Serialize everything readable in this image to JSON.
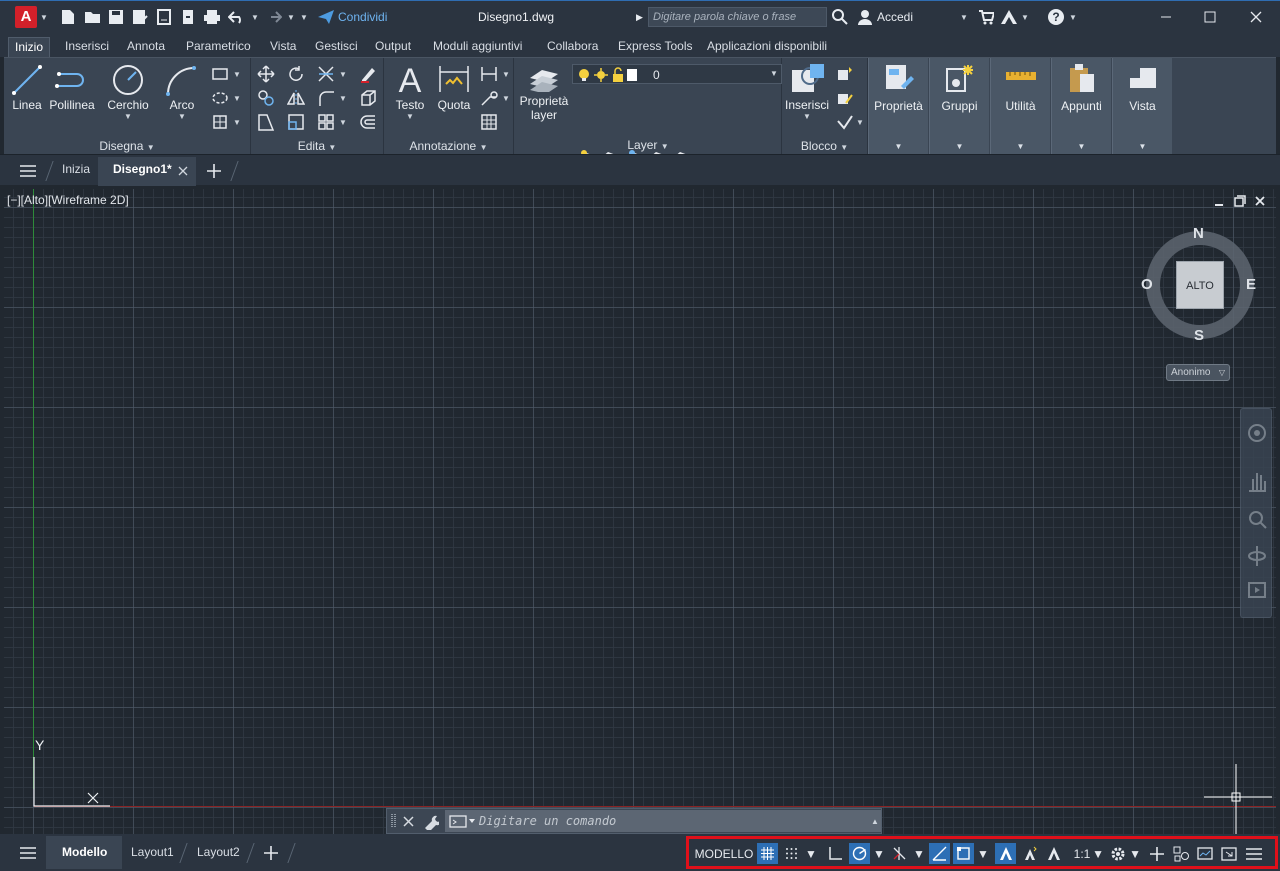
{
  "app": {
    "logo_letter": "A",
    "document_title": "Disegno1.dwg",
    "share_label": "Condividi",
    "search_placeholder": "Digitare parola chiave o frase",
    "signin_label": "Accedi"
  },
  "ribbon_tabs": [
    "Inizio",
    "Inserisci",
    "Annota",
    "Parametrico",
    "Vista",
    "Gestisci",
    "Output",
    "Moduli aggiuntivi",
    "Collabora",
    "Express Tools",
    "Applicazioni disponibili"
  ],
  "ribbon": {
    "draw": {
      "title": "Disegna",
      "line": "Linea",
      "polyline": "Polilinea",
      "circle": "Cerchio",
      "arc": "Arco"
    },
    "modify": {
      "title": "Edita"
    },
    "annotation": {
      "title": "Annotazione",
      "text": "Testo",
      "dimension": "Quota"
    },
    "layers": {
      "title": "Layer",
      "properties_l1": "Proprietà",
      "properties_l2": "layer",
      "current_layer": "0"
    },
    "block": {
      "title": "Blocco",
      "insert": "Inserisci"
    },
    "properties": "Proprietà",
    "groups": "Gruppi",
    "utilities": "Utilità",
    "clipboard": "Appunti",
    "view": "Vista"
  },
  "file_tabs": {
    "start": "Inizia",
    "drawing": "Disegno1*"
  },
  "viewport": {
    "label": "[−][Alto][Wireframe 2D]",
    "compass": {
      "n": "N",
      "s": "S",
      "e": "E",
      "w": "O",
      "top": "ALTO"
    },
    "ucs_name": "Anonimo",
    "y_axis": "Y"
  },
  "command_line": {
    "placeholder": "Digitare un comando"
  },
  "layout_tabs": [
    "Modello",
    "Layout1",
    "Layout2"
  ],
  "status_bar": {
    "model_label": "MODELLO",
    "scale_label": "1:1"
  },
  "colors": {
    "accent": "#2d6fb5",
    "highlight": "#e0101a",
    "ribbon_bg": "#3a4553",
    "canvas_bg": "#212830",
    "logo": "#d3202a"
  }
}
